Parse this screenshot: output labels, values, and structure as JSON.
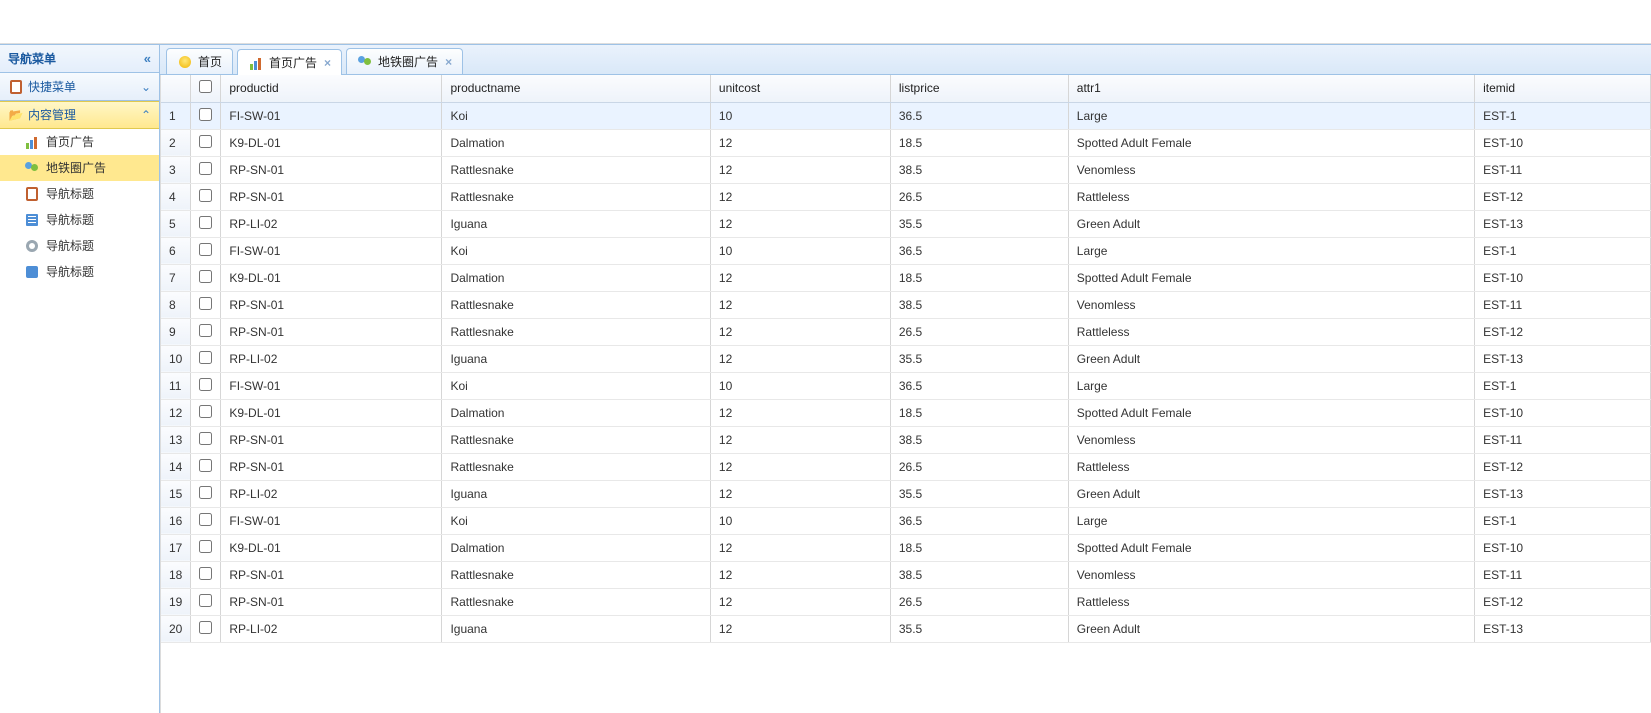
{
  "sidebar": {
    "title": "导航菜单",
    "sections": {
      "quick": {
        "label": "快捷菜单"
      },
      "content": {
        "label": "内容管理"
      }
    },
    "items": [
      {
        "label": "首页广告",
        "icon": "bars-icon",
        "selected": false
      },
      {
        "label": "地铁圈广告",
        "icon": "people-icon",
        "selected": true
      },
      {
        "label": "导航标题",
        "icon": "clipboard-icon",
        "selected": false
      },
      {
        "label": "导航标题",
        "icon": "book-icon",
        "selected": false
      },
      {
        "label": "导航标题",
        "icon": "gear-icon",
        "selected": false
      },
      {
        "label": "导航标题",
        "icon": "disk-icon",
        "selected": false
      }
    ]
  },
  "tabs": [
    {
      "label": "首页",
      "icon": "bulb-icon",
      "closable": false,
      "active": false
    },
    {
      "label": "首页广告",
      "icon": "bars-icon",
      "closable": true,
      "active": true
    },
    {
      "label": "地铁圈广告",
      "icon": "people-icon",
      "closable": true,
      "active": false
    }
  ],
  "grid": {
    "columns": [
      "productid",
      "productname",
      "unitcost",
      "listprice",
      "attr1",
      "itemid"
    ],
    "rows": [
      {
        "productid": "FI-SW-01",
        "productname": "Koi",
        "unitcost": "10",
        "listprice": "36.5",
        "attr1": "Large",
        "itemid": "EST-1"
      },
      {
        "productid": "K9-DL-01",
        "productname": "Dalmation",
        "unitcost": "12",
        "listprice": "18.5",
        "attr1": "Spotted Adult Female",
        "itemid": "EST-10"
      },
      {
        "productid": "RP-SN-01",
        "productname": "Rattlesnake",
        "unitcost": "12",
        "listprice": "38.5",
        "attr1": "Venomless",
        "itemid": "EST-11"
      },
      {
        "productid": "RP-SN-01",
        "productname": "Rattlesnake",
        "unitcost": "12",
        "listprice": "26.5",
        "attr1": "Rattleless",
        "itemid": "EST-12"
      },
      {
        "productid": "RP-LI-02",
        "productname": "Iguana",
        "unitcost": "12",
        "listprice": "35.5",
        "attr1": "Green Adult",
        "itemid": "EST-13"
      },
      {
        "productid": "FI-SW-01",
        "productname": "Koi",
        "unitcost": "10",
        "listprice": "36.5",
        "attr1": "Large",
        "itemid": "EST-1"
      },
      {
        "productid": "K9-DL-01",
        "productname": "Dalmation",
        "unitcost": "12",
        "listprice": "18.5",
        "attr1": "Spotted Adult Female",
        "itemid": "EST-10"
      },
      {
        "productid": "RP-SN-01",
        "productname": "Rattlesnake",
        "unitcost": "12",
        "listprice": "38.5",
        "attr1": "Venomless",
        "itemid": "EST-11"
      },
      {
        "productid": "RP-SN-01",
        "productname": "Rattlesnake",
        "unitcost": "12",
        "listprice": "26.5",
        "attr1": "Rattleless",
        "itemid": "EST-12"
      },
      {
        "productid": "RP-LI-02",
        "productname": "Iguana",
        "unitcost": "12",
        "listprice": "35.5",
        "attr1": "Green Adult",
        "itemid": "EST-13"
      },
      {
        "productid": "FI-SW-01",
        "productname": "Koi",
        "unitcost": "10",
        "listprice": "36.5",
        "attr1": "Large",
        "itemid": "EST-1"
      },
      {
        "productid": "K9-DL-01",
        "productname": "Dalmation",
        "unitcost": "12",
        "listprice": "18.5",
        "attr1": "Spotted Adult Female",
        "itemid": "EST-10"
      },
      {
        "productid": "RP-SN-01",
        "productname": "Rattlesnake",
        "unitcost": "12",
        "listprice": "38.5",
        "attr1": "Venomless",
        "itemid": "EST-11"
      },
      {
        "productid": "RP-SN-01",
        "productname": "Rattlesnake",
        "unitcost": "12",
        "listprice": "26.5",
        "attr1": "Rattleless",
        "itemid": "EST-12"
      },
      {
        "productid": "RP-LI-02",
        "productname": "Iguana",
        "unitcost": "12",
        "listprice": "35.5",
        "attr1": "Green Adult",
        "itemid": "EST-13"
      },
      {
        "productid": "FI-SW-01",
        "productname": "Koi",
        "unitcost": "10",
        "listprice": "36.5",
        "attr1": "Large",
        "itemid": "EST-1"
      },
      {
        "productid": "K9-DL-01",
        "productname": "Dalmation",
        "unitcost": "12",
        "listprice": "18.5",
        "attr1": "Spotted Adult Female",
        "itemid": "EST-10"
      },
      {
        "productid": "RP-SN-01",
        "productname": "Rattlesnake",
        "unitcost": "12",
        "listprice": "38.5",
        "attr1": "Venomless",
        "itemid": "EST-11"
      },
      {
        "productid": "RP-SN-01",
        "productname": "Rattlesnake",
        "unitcost": "12",
        "listprice": "26.5",
        "attr1": "Rattleless",
        "itemid": "EST-12"
      },
      {
        "productid": "RP-LI-02",
        "productname": "Iguana",
        "unitcost": "12",
        "listprice": "35.5",
        "attr1": "Green Adult",
        "itemid": "EST-13"
      }
    ]
  }
}
